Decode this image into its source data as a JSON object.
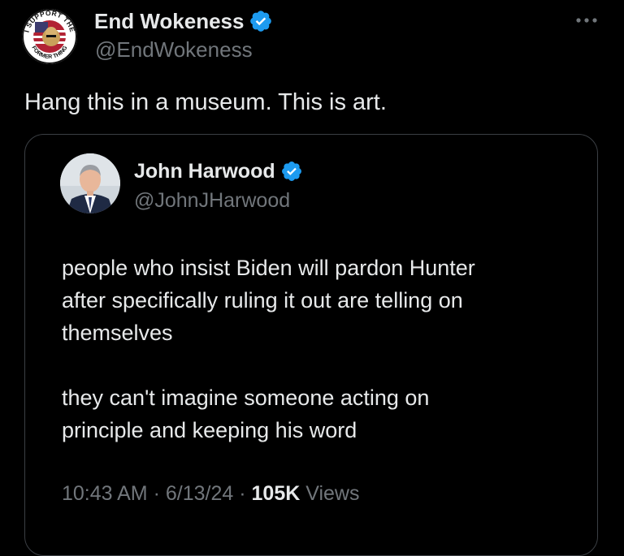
{
  "tweet": {
    "author": {
      "name": "End Wokeness",
      "handle": "@EndWokeness",
      "verified": true,
      "avatar_badge": {
        "top_text": "I SUPPORT THE",
        "bottom_text": "FORMER THING"
      }
    },
    "more_icon": "ellipsis-icon",
    "text": "Hang this in a museum. This is art.",
    "quoted": {
      "author": {
        "name": "John Harwood",
        "handle": "@JohnJHarwood",
        "verified": true
      },
      "paragraphs": [
        "people who insist Biden will pardon Hunter\nafter specifically ruling it out are telling on\nthemselves",
        "they can't imagine someone acting on\nprinciple and keeping his word"
      ],
      "time": "10:43 AM",
      "date": "6/13/24",
      "separator": "·",
      "views_count": "105K",
      "views_label": "Views"
    }
  },
  "colors": {
    "background": "#000000",
    "text_primary": "#e7e9ea",
    "text_secondary": "#71767b",
    "verified_blue": "#1d9bf0",
    "card_border": "#3b3f44"
  }
}
